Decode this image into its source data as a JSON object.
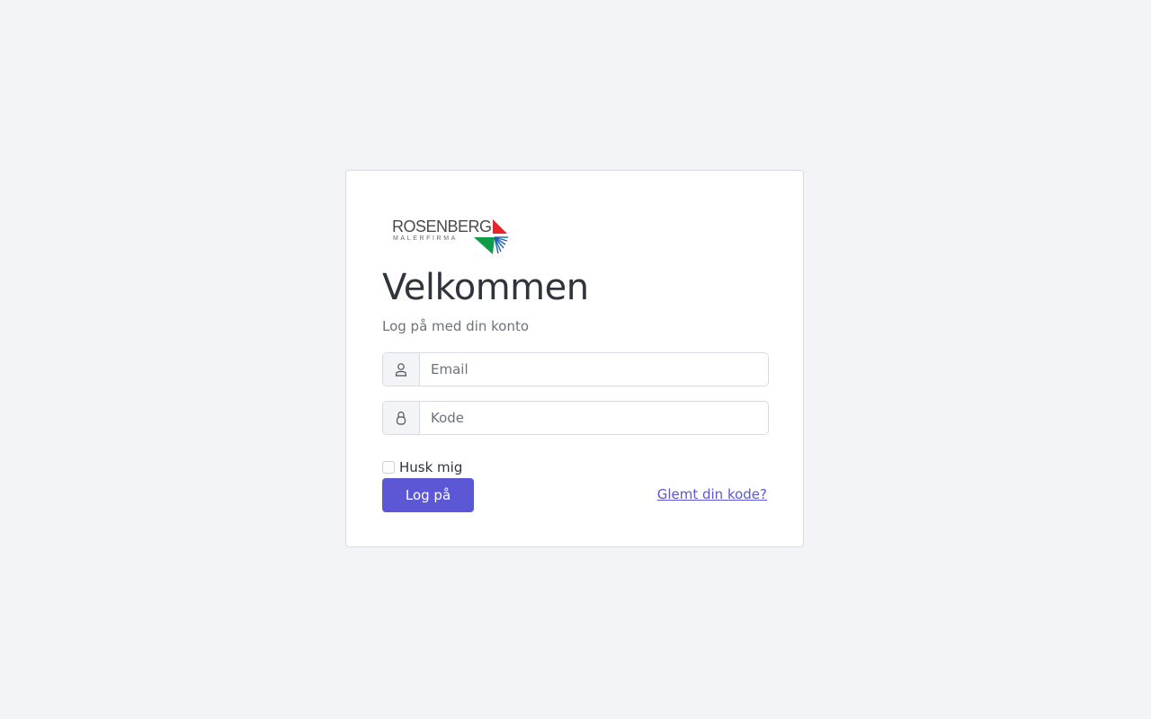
{
  "brand": {
    "name": "ROSENBERG",
    "tagline": "MALERFIRMA",
    "colors": {
      "red": "#e4252d",
      "green": "#0f9b48",
      "blue": "#1f63ae"
    }
  },
  "login": {
    "title": "Velkommen",
    "subtitle": "Log på med din konto",
    "email_placeholder": "Email",
    "email_icon": "user-icon",
    "password_placeholder": "Kode",
    "password_icon": "lock-icon",
    "remember_label": "Husk mig",
    "remember_checked": false,
    "submit_label": "Log på",
    "forgot_label": "Glemt din kode?"
  },
  "theme": {
    "background": "#f2f4f7",
    "accent": "#5b57d5"
  }
}
